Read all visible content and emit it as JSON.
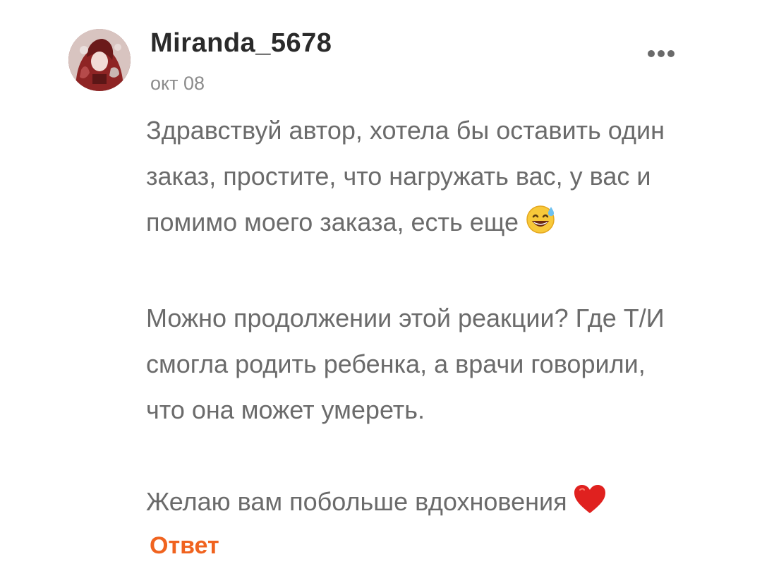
{
  "comment": {
    "username": "Miranda_5678",
    "date": "окт 08",
    "paragraphs": [
      {
        "lines": [
          "Здравствуй автор, хотела бы оставить один",
          "заказ, простите, что нагружать вас, у вас и",
          "помимо моего заказа, есть еще"
        ],
        "trailing_emoji": "grinning-face-with-sweat-icon"
      },
      {
        "lines": [
          "Можно продолжении этой реакции? Где Т/И",
          "смогла родить ребенка, а врачи говорили,",
          "что она может умереть."
        ]
      },
      {
        "lines": [
          "Желаю вам побольше вдохновения"
        ],
        "trailing_emoji": "red-heart-icon"
      }
    ],
    "reply_label": "Ответ",
    "more_icon": "more-horizontal-icon"
  },
  "colors": {
    "username": "#2a2a2a",
    "date": "#8c8c8c",
    "body_text": "#6b6b6b",
    "reply_accent": "#f0631f",
    "background": "#ffffff"
  }
}
